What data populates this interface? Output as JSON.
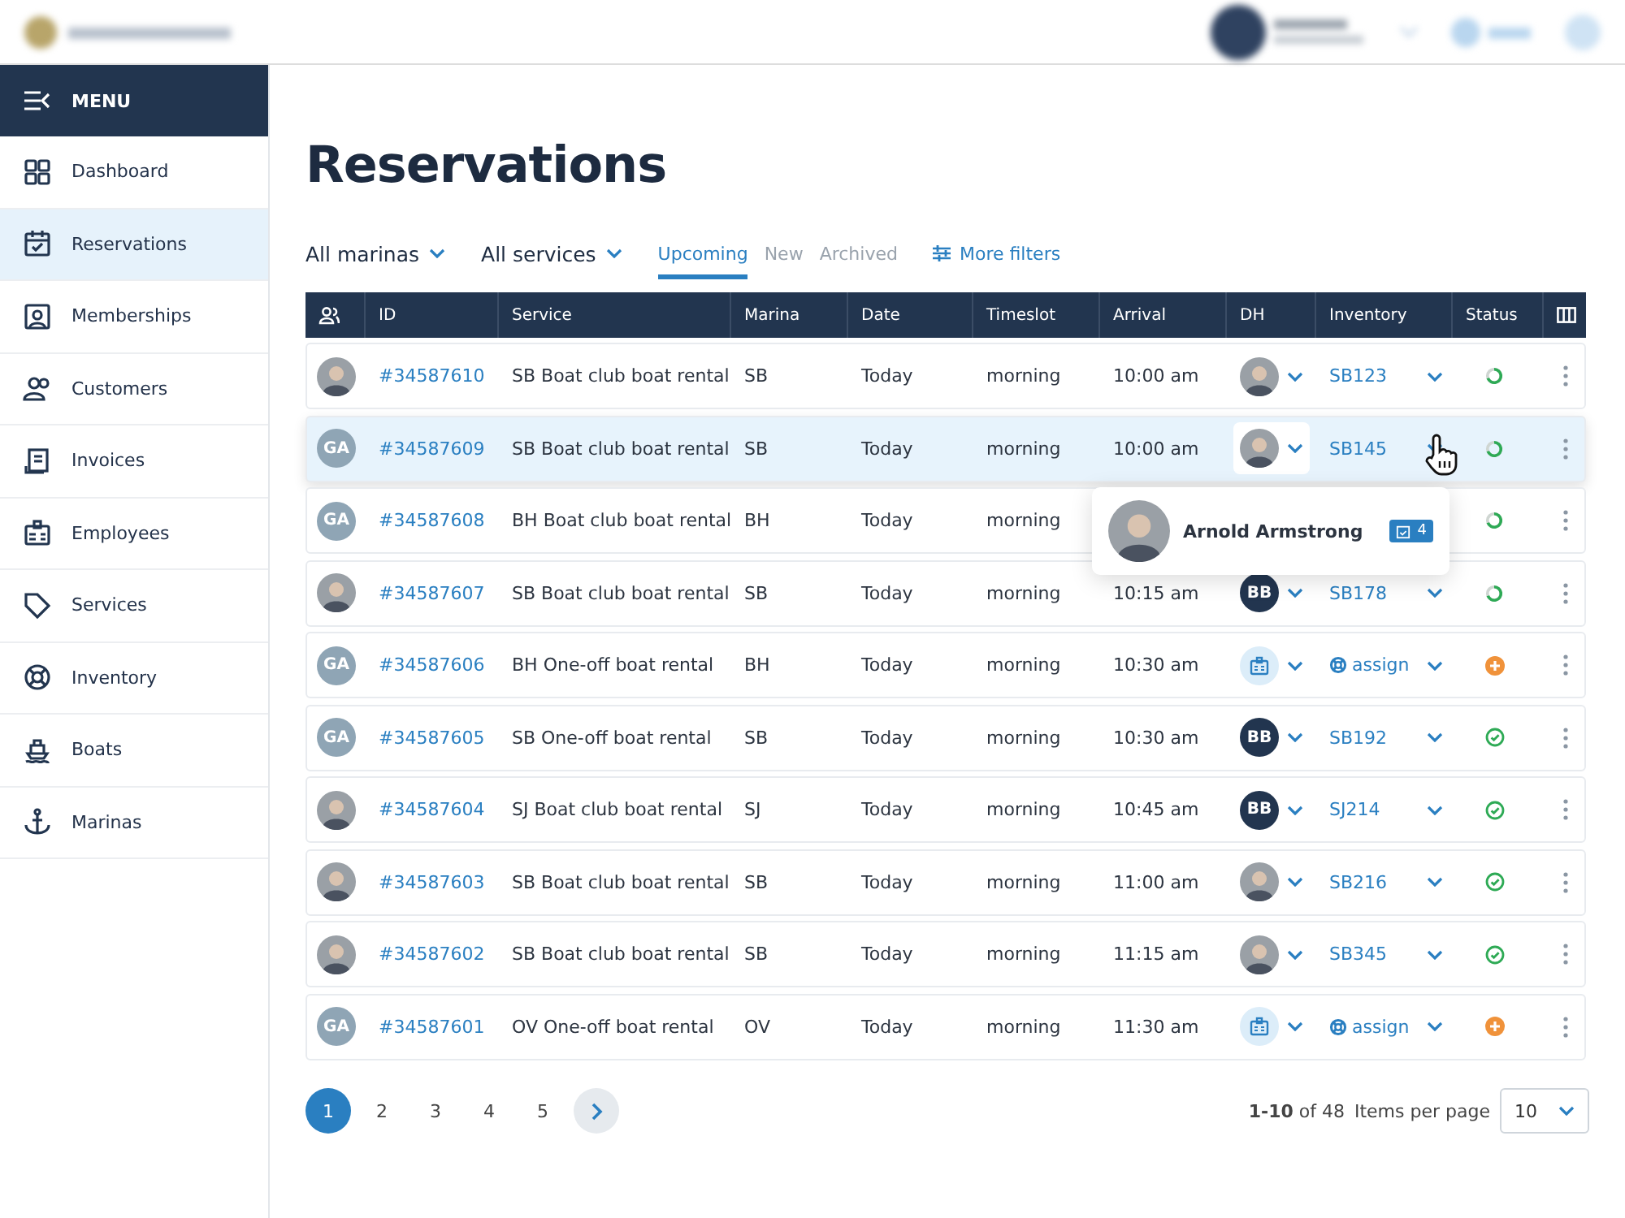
{
  "sidebar": {
    "menu_label": "MENU",
    "items": [
      {
        "label": "Dashboard",
        "selected": false
      },
      {
        "label": "Reservations",
        "selected": true
      },
      {
        "label": "Memberships",
        "selected": false
      },
      {
        "label": "Customers",
        "selected": false
      },
      {
        "label": "Invoices",
        "selected": false
      },
      {
        "label": "Employees",
        "selected": false
      },
      {
        "label": "Services",
        "selected": false
      },
      {
        "label": "Inventory",
        "selected": false
      },
      {
        "label": "Boats",
        "selected": false
      },
      {
        "label": "Marinas",
        "selected": false
      }
    ]
  },
  "title": "Reservations",
  "filters": {
    "dropdowns": [
      "All marinas",
      "All services"
    ],
    "tabs": [
      {
        "label": "Upcoming",
        "selected": true
      },
      {
        "label": "New",
        "selected": false
      },
      {
        "label": "Archived",
        "selected": false
      }
    ],
    "more": "More filters"
  },
  "table": {
    "columns": [
      "ID",
      "Service",
      "Marina",
      "Date",
      "Timeslot",
      "Arrival",
      "DH",
      "Inventory",
      "Status"
    ],
    "rows": [
      {
        "selected": false,
        "customer": {
          "kind": "photo"
        },
        "id": "#34587610",
        "service": "SB Boat club boat rental",
        "marina": "SB",
        "date": "Today",
        "timeslot": "morning",
        "arrival": "10:00 am",
        "dh": {
          "kind": "photo"
        },
        "inventory": {
          "kind": "code",
          "text": "SB123"
        },
        "status": {
          "kind": "progress"
        }
      },
      {
        "selected": true,
        "customer": {
          "kind": "initials",
          "text": "GA"
        },
        "id": "#34587609",
        "service": "SB Boat club boat rental",
        "marina": "SB",
        "date": "Today",
        "timeslot": "morning",
        "arrival": "10:00 am",
        "dh": {
          "kind": "photo"
        },
        "inventory": {
          "kind": "code",
          "text": "SB145"
        },
        "status": {
          "kind": "progress"
        }
      },
      {
        "selected": false,
        "customer": {
          "kind": "initials",
          "text": "GA"
        },
        "id": "#34587608",
        "service": "BH Boat club boat rental",
        "marina": "BH",
        "date": "Today",
        "timeslot": "morning",
        "status": {
          "kind": "progress"
        }
      },
      {
        "selected": false,
        "customer": {
          "kind": "photo"
        },
        "id": "#34587607",
        "service": "SB Boat club boat rental",
        "marina": "SB",
        "date": "Today",
        "timeslot": "morning",
        "arrival": "10:15 am",
        "dh": {
          "kind": "initials",
          "text": "BB"
        },
        "inventory": {
          "kind": "code",
          "text": "SB178"
        },
        "status": {
          "kind": "progress"
        }
      },
      {
        "selected": false,
        "customer": {
          "kind": "initials",
          "text": "GA"
        },
        "id": "#34587606",
        "service": "BH One-off  boat rental",
        "marina": "BH",
        "date": "Today",
        "timeslot": "morning",
        "arrival": "10:30 am",
        "dh": {
          "kind": "unassigned"
        },
        "inventory": {
          "kind": "assign",
          "text": "assign"
        },
        "status": {
          "kind": "pending"
        }
      },
      {
        "selected": false,
        "customer": {
          "kind": "initials",
          "text": "GA"
        },
        "id": "#34587605",
        "service": "SB One-off boat rental",
        "marina": "SB",
        "date": "Today",
        "timeslot": "morning",
        "arrival": "10:30 am",
        "dh": {
          "kind": "initials",
          "text": "BB"
        },
        "inventory": {
          "kind": "code",
          "text": "SB192"
        },
        "status": {
          "kind": "done"
        }
      },
      {
        "selected": false,
        "customer": {
          "kind": "photo"
        },
        "id": "#34587604",
        "service": "SJ Boat club boat rental",
        "marina": "SJ",
        "date": "Today",
        "timeslot": "morning",
        "arrival": "10:45 am",
        "dh": {
          "kind": "initials",
          "text": "BB"
        },
        "inventory": {
          "kind": "code",
          "text": "SJ214"
        },
        "status": {
          "kind": "done"
        }
      },
      {
        "selected": false,
        "customer": {
          "kind": "photo"
        },
        "id": "#34587603",
        "service": "SB Boat club boat rental",
        "marina": "SB",
        "date": "Today",
        "timeslot": "morning",
        "arrival": "11:00 am",
        "dh": {
          "kind": "photo"
        },
        "inventory": {
          "kind": "code",
          "text": "SB216"
        },
        "status": {
          "kind": "done"
        }
      },
      {
        "selected": false,
        "customer": {
          "kind": "photo"
        },
        "id": "#34587602",
        "service": "SB Boat club boat rental",
        "marina": "SB",
        "date": "Today",
        "timeslot": "morning",
        "arrival": "11:15 am",
        "dh": {
          "kind": "photo"
        },
        "inventory": {
          "kind": "code",
          "text": "SB345"
        },
        "status": {
          "kind": "done"
        }
      },
      {
        "selected": false,
        "customer": {
          "kind": "initials",
          "text": "GA"
        },
        "id": "#34587601",
        "service": "OV One-off boat rental",
        "marina": "OV",
        "date": "Today",
        "timeslot": "morning",
        "arrival": "11:30 am",
        "dh": {
          "kind": "unassigned"
        },
        "inventory": {
          "kind": "assign",
          "text": "assign"
        },
        "status": {
          "kind": "pending"
        }
      }
    ]
  },
  "popover": {
    "name": "Arnold Armstrong",
    "count": "4"
  },
  "pagination": {
    "pages": [
      {
        "label": "1",
        "selected": true
      },
      {
        "label": "2",
        "selected": false
      },
      {
        "label": "3",
        "selected": false
      },
      {
        "label": "4",
        "selected": false
      },
      {
        "label": "5",
        "selected": false
      }
    ],
    "range": "**1-10** of 48",
    "per_page_label": "Items per page",
    "per_page": "10"
  }
}
